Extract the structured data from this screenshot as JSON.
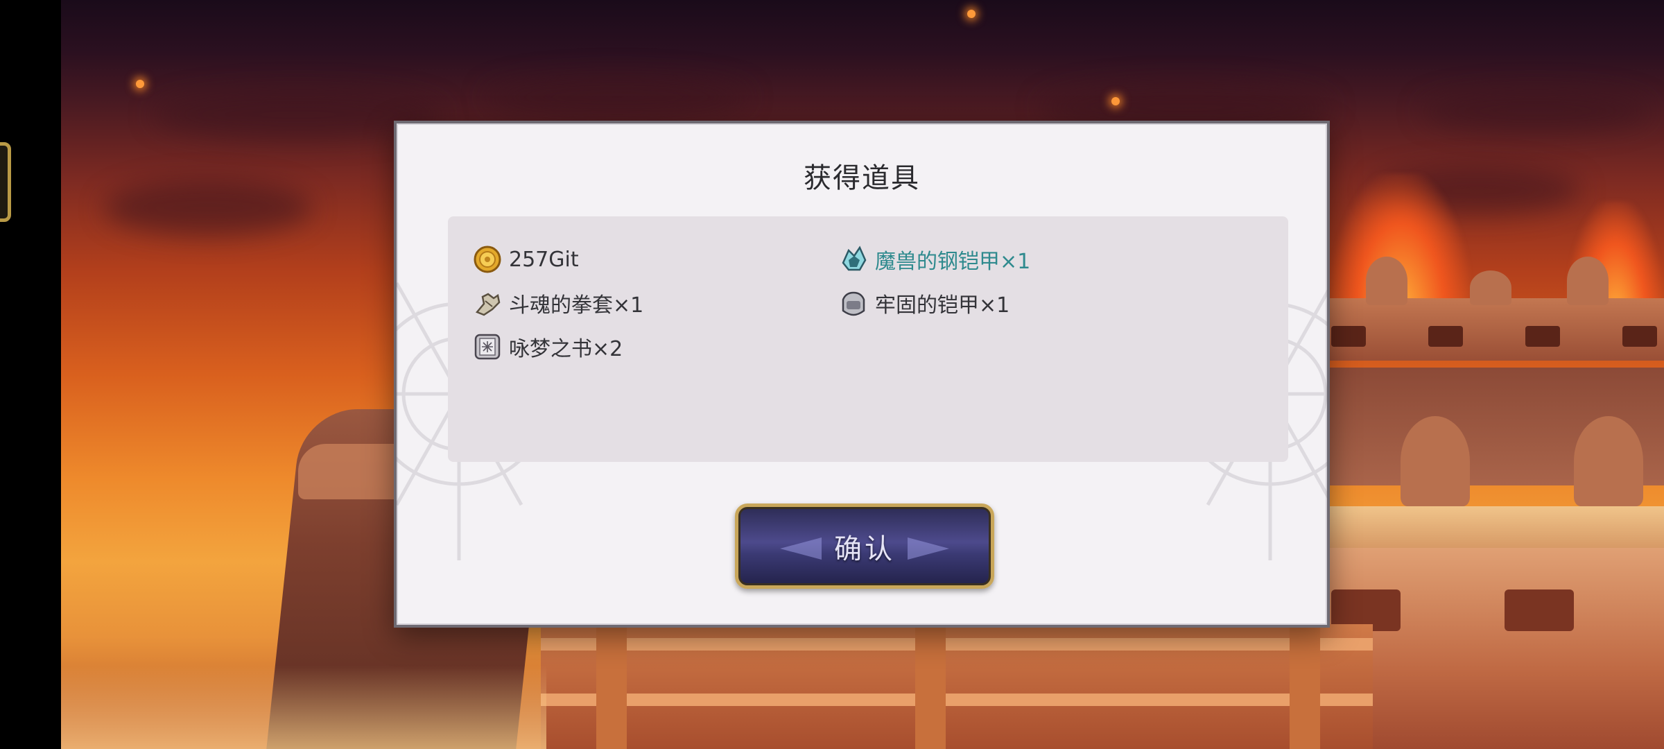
{
  "dialog": {
    "title": "获得道具",
    "items": [
      {
        "label": "257Git",
        "icon": "gold-coin-icon",
        "highlight": false
      },
      {
        "label": "魔兽的钢铠甲×1",
        "icon": "crystal-armor-icon",
        "highlight": true
      },
      {
        "label": "斗魂的拳套×1",
        "icon": "gauntlet-icon",
        "highlight": false
      },
      {
        "label": "牢固的铠甲×1",
        "icon": "steel-armor-icon",
        "highlight": false
      },
      {
        "label": "咏梦之书×2",
        "icon": "book-icon",
        "highlight": false
      }
    ],
    "confirm_label": "确认"
  },
  "colors": {
    "highlight_text": "#2f8a8e",
    "button_border": "#c9a75a",
    "button_fill": "#4d4a8c",
    "panel_bg": "#e4dfe4"
  }
}
